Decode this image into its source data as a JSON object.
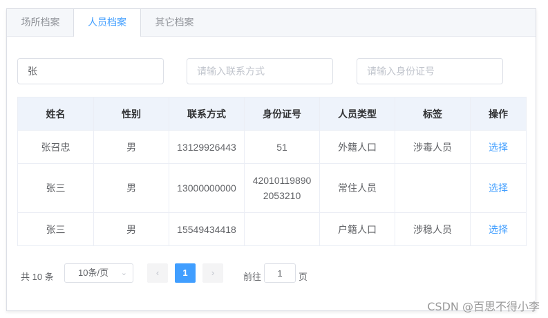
{
  "tabs": [
    {
      "label": "场所档案",
      "active": false
    },
    {
      "label": "人员档案",
      "active": true
    },
    {
      "label": "其它档案",
      "active": false
    }
  ],
  "filters": {
    "name_value": "张",
    "phone_placeholder": "请输入联系方式",
    "idcard_placeholder": "请输入身份证号"
  },
  "table": {
    "headers": [
      "姓名",
      "性别",
      "联系方式",
      "身份证号",
      "人员类型",
      "标签",
      "操作"
    ],
    "rows": [
      {
        "name": "张召忠",
        "gender": "男",
        "phone": "13129926443",
        "idcard_line1": "51",
        "idcard_line2": "",
        "type": "外籍人口",
        "tag": "涉毒人员",
        "action": "选择"
      },
      {
        "name": "张三",
        "gender": "男",
        "phone": "13000000000",
        "idcard_line1": "42010119890",
        "idcard_line2": "2053210",
        "type": "常住人员",
        "tag": "",
        "action": "选择"
      },
      {
        "name": "张三",
        "gender": "男",
        "phone": "15549434418",
        "idcard_line1": "",
        "idcard_line2": "",
        "type": "户籍人口",
        "tag": "涉稳人员",
        "action": "选择"
      }
    ]
  },
  "pagination": {
    "total_text": "共 10 条",
    "page_size": "10条/页",
    "prev_icon": "‹",
    "current_page": "1",
    "next_icon": "›",
    "goto_label": "前往",
    "goto_value": "1",
    "page_suffix": "页"
  },
  "watermark": "CSDN @百思不得小李",
  "colors": {
    "accent": "#409eff",
    "border": "#dcdfe6",
    "header_bg": "#eef3fb"
  }
}
